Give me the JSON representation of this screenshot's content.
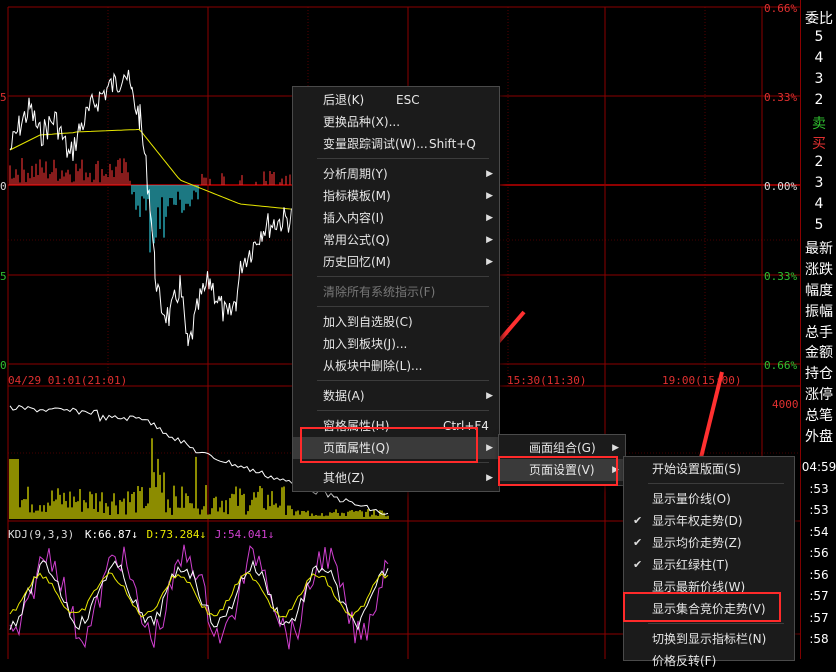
{
  "chart": {
    "date_label": "04/29  01:01(21:01)",
    "time_mid": "15:30(11:30)",
    "time_right": "19:00(15:00)",
    "right_axis": [
      "0.66%",
      "0.33%",
      "0.00%",
      "0.33%",
      "0.66%"
    ],
    "left_axis": [
      "5",
      "0",
      "5",
      "0"
    ],
    "volume_axis": "4000",
    "kdj_label": "KDJ(9,3,3)",
    "k_label": "K:66.87↓",
    "d_label": "D:73.284↓",
    "j_label": "J:54.041↓"
  },
  "sidebar": {
    "items": [
      "委比",
      "5",
      "4",
      "3",
      "2",
      "卖",
      "买",
      "2",
      "3",
      "4",
      "5",
      "最新",
      "涨跌",
      "幅度",
      "振幅",
      "总手",
      "金额",
      "持仓",
      "涨停",
      "总笔",
      "外盘",
      "04:59",
      ":53",
      ":53",
      ":54",
      ":56",
      ":56",
      ":57",
      ":57",
      ":58"
    ]
  },
  "context_menu": {
    "items": [
      {
        "label": "后退(K)",
        "shortcut": "ESC"
      },
      {
        "label": "更换品种(X)..."
      },
      {
        "label": "变量跟踪调试(W)...",
        "shortcut": "Shift+Q"
      },
      {
        "label": "分析周期(Y)",
        "submenu": true
      },
      {
        "label": "指标模板(M)",
        "submenu": true
      },
      {
        "label": "插入内容(I)",
        "submenu": true
      },
      {
        "label": "常用公式(Q)",
        "submenu": true
      },
      {
        "label": "历史回忆(M)",
        "submenu": true
      },
      {
        "label": "清除所有系统指示(F)",
        "disabled": true
      },
      {
        "label": "加入到自选股(C)"
      },
      {
        "label": "加入到板块(J)..."
      },
      {
        "label": "从板块中删除(L)..."
      },
      {
        "label": "数据(A)",
        "submenu": true
      },
      {
        "label": "窗格属性(H)",
        "shortcut": "Ctrl+F4"
      },
      {
        "label": "页面属性(Q)",
        "submenu": true
      },
      {
        "label": "其他(Z)",
        "submenu": true
      }
    ]
  },
  "page_submenu": {
    "items": [
      {
        "label": "画面组合(G)",
        "submenu": true
      },
      {
        "label": "页面设置(V)",
        "submenu": true
      }
    ]
  },
  "settings_submenu": {
    "items": [
      {
        "label": "开始设置版面(S)"
      },
      {
        "label": "显示量价线(O)"
      },
      {
        "label": "显示年权走势(D)",
        "checked": true
      },
      {
        "label": "显示均价走势(Z)",
        "checked": true
      },
      {
        "label": "显示红绿柱(T)",
        "checked": true
      },
      {
        "label": "显示最新价线(W)"
      },
      {
        "label": "显示集合竞价走势(V)"
      },
      {
        "label": "切换到显示指标栏(N)"
      },
      {
        "label": "价格反转(F)"
      }
    ]
  },
  "colors": {
    "grid_red": "#8b0000",
    "price_line": "#ffffff",
    "avg_line": "#e6e600",
    "bar_up": "#e03030",
    "bar_down": "#30c8d8",
    "volume": "#e8e800",
    "k_line": "#ffffff",
    "d_line": "#e8e800",
    "j_line": "#d040d0",
    "highlight_box": "#ff2a2a",
    "arrow": "#ff3030"
  }
}
